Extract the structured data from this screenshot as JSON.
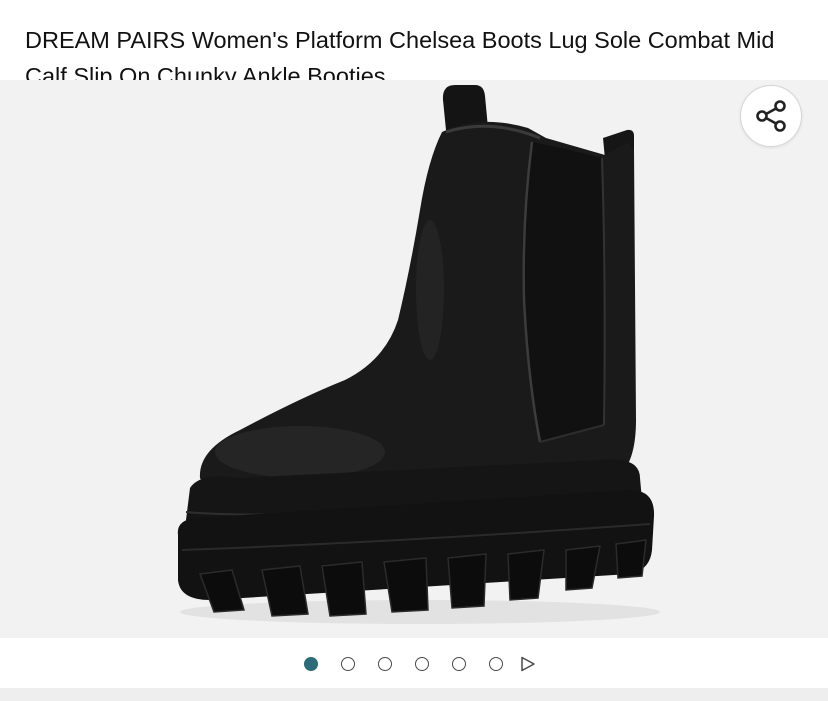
{
  "product": {
    "title": "DREAM PAIRS Women's Platform Chelsea Boots Lug Sole Combat Mid Calf Slip On Chunky Ankle Booties"
  },
  "gallery": {
    "image_alt": "Black platform chelsea boot",
    "share_icon": "share-icon",
    "active_index": 0,
    "dot_count": 6,
    "play_icon": "play-triangle-icon",
    "colors": {
      "background": "#f2f2f2",
      "active_dot": "#2c6b77",
      "boot": "#1a1a1a"
    }
  }
}
